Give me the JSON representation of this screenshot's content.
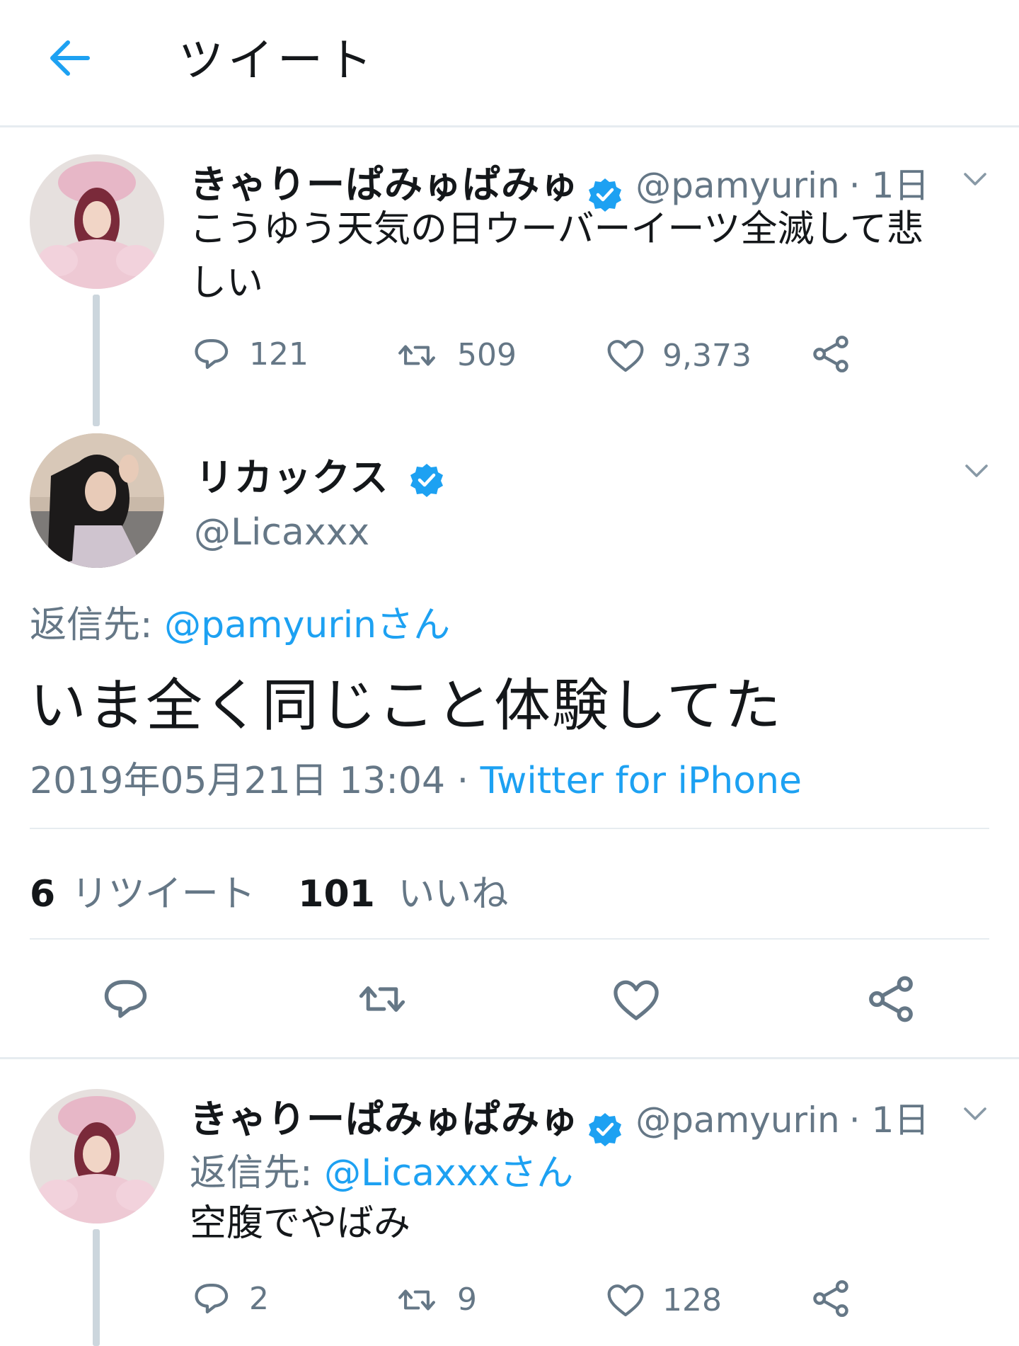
{
  "header": {
    "title": "ツイート"
  },
  "tweet1": {
    "name": "きゃりーぱみゅぱみゅ",
    "handle": "@pamyurin",
    "time": "· 1日",
    "text_line1": "こうゆう天気の日ウーバーイーツ全滅して悲",
    "text_line2": "しい",
    "replies": "121",
    "retweets": "509",
    "likes": "9,373"
  },
  "main": {
    "name": "リカックス",
    "handle": "@Licaxxx",
    "reply_prefix": "返信先:",
    "reply_to": "@pamyurinさん",
    "text": "いま全く同じこと体験してた",
    "date": "2019年05月21日 13:04",
    "date_sep": " · ",
    "source": "Twitter for iPhone",
    "retweet_count": "6",
    "retweet_label": "リツイート",
    "like_count": "101",
    "like_label": "いいね"
  },
  "tweet3": {
    "name": "きゃりーぱみゅぱみゅ",
    "handle": "@pamyurin",
    "time": "· 1日",
    "reply_prefix": "返信先:",
    "reply_to": "@Licaxxxさん",
    "text": "空腹でやばみ",
    "replies": "2",
    "retweets": "9",
    "likes": "128"
  },
  "colors": {
    "accent": "#1da1f2",
    "text": "#14171a",
    "secondary": "#657786",
    "divider": "#e6ecf0"
  }
}
